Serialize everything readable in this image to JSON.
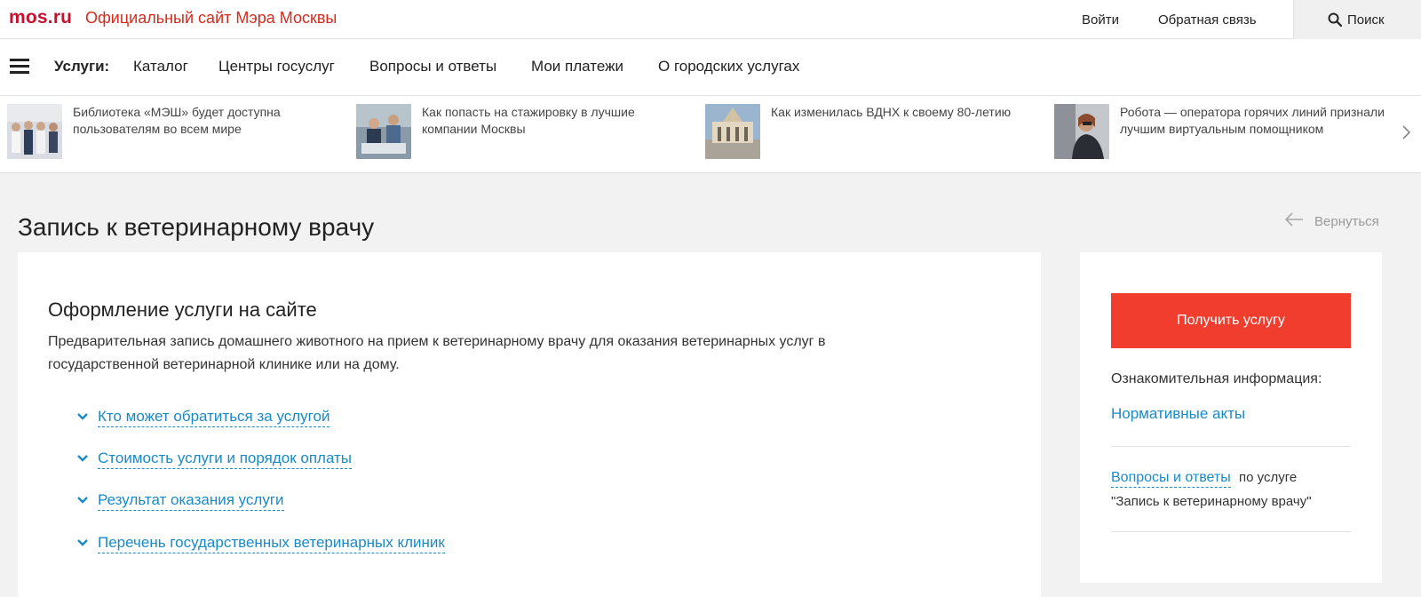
{
  "header": {
    "logo": "mos.ru",
    "site_title": "Официальный сайт Мэра Москвы",
    "login": "Войти",
    "feedback": "Обратная связь",
    "search": "Поиск"
  },
  "nav": {
    "title": "Услуги:",
    "items": [
      "Каталог",
      "Центры госуслуг",
      "Вопросы и ответы",
      "Мои платежи",
      "О городских услугах"
    ]
  },
  "news": [
    {
      "text": "Библиотека «МЭШ» будет доступна пользователям во всем мире"
    },
    {
      "text": "Как попасть на стажировку в лучшие компании Москвы"
    },
    {
      "text": "Как изменилась ВДНХ к своему 80-летию"
    },
    {
      "text": "Робота — оператора горячих линий признали лучшим виртуальным помощником"
    }
  ],
  "page": {
    "title": "Запись к ветеринарному врачу",
    "back": "Вернуться"
  },
  "main": {
    "section_title": "Оформление услуги на сайте",
    "description": "Предварительная запись домашнего животного на прием к ветеринарному врачу для оказания ветеринарных услуг в государственной ветеринарной клинике или на дому.",
    "accordions": [
      "Кто может обратиться за услугой",
      "Стоимость услуги и порядок оплаты",
      "Результат оказания услуги",
      "Перечень государственных ветеринарных клиник"
    ]
  },
  "sidebar": {
    "cta": "Получить услугу",
    "info_label": "Ознакомительная информация:",
    "normative_link": "Нормативные акты",
    "qa_link": "Вопросы и ответы",
    "qa_suffix": "по услуге",
    "qa_service": "\"Запись к ветеринарному врачу\""
  },
  "colors": {
    "brand_red": "#d52b1e",
    "cta_red": "#f03d2e",
    "link_blue": "#1a8ac7"
  }
}
